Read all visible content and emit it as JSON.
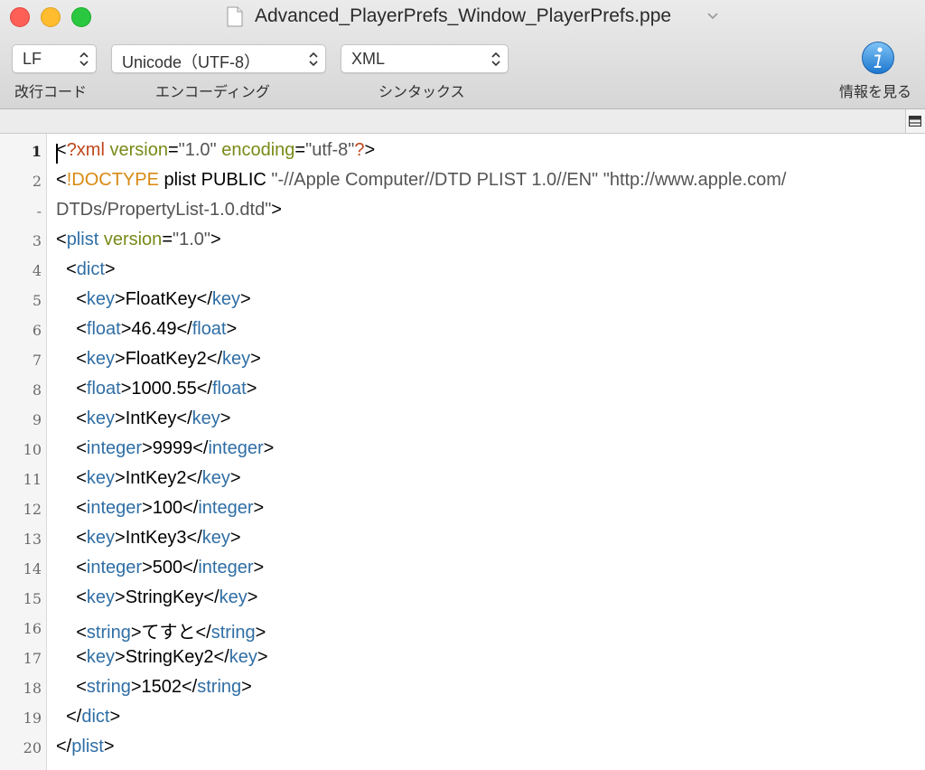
{
  "window": {
    "title": "Advanced_PlayerPrefs_Window_PlayerPrefs.ppe"
  },
  "toolbar": {
    "line_ending": {
      "value": "LF",
      "label": "改行コード"
    },
    "encoding": {
      "value": "Unicode（UTF-8）",
      "label": "エンコーディング"
    },
    "syntax": {
      "value": "XML",
      "label": "シンタックス"
    },
    "info": {
      "label": "情報を見る",
      "icon": "info-icon"
    }
  },
  "colors": {
    "tag": "#2f6ea5",
    "attribute": "#7a8a18",
    "value": "#555555",
    "declaration": "#c0471c",
    "doctype": "#d88a12",
    "text": "#000000"
  },
  "editor": {
    "current_line": 1,
    "lines": [
      {
        "number": "1",
        "tokens": [
          {
            "t": "<",
            "c": "text"
          },
          {
            "t": "?xml",
            "c": "declaration"
          },
          {
            "t": " ",
            "c": "text"
          },
          {
            "t": "version",
            "c": "attribute"
          },
          {
            "t": "=",
            "c": "text"
          },
          {
            "t": "\"1.0\"",
            "c": "value"
          },
          {
            "t": " ",
            "c": "text"
          },
          {
            "t": "encoding",
            "c": "attribute"
          },
          {
            "t": "=",
            "c": "text"
          },
          {
            "t": "\"utf-8\"",
            "c": "value"
          },
          {
            "t": "?",
            "c": "declaration"
          },
          {
            "t": ">",
            "c": "text"
          }
        ]
      },
      {
        "number": "2",
        "tokens": [
          {
            "t": "<",
            "c": "text"
          },
          {
            "t": "!DOCTYPE",
            "c": "doctype"
          },
          {
            "t": " plist PUBLIC ",
            "c": "text"
          },
          {
            "t": "\"-//Apple Computer//DTD PLIST 1.0//EN\" \"http://www.apple.com/",
            "c": "value"
          }
        ]
      },
      {
        "number": "-",
        "tokens": [
          {
            "t": "DTDs/PropertyList-1.0.dtd\"",
            "c": "value"
          },
          {
            "t": ">",
            "c": "text"
          }
        ]
      },
      {
        "number": "3",
        "tokens": [
          {
            "t": "<",
            "c": "text"
          },
          {
            "t": "plist",
            "c": "tag"
          },
          {
            "t": " ",
            "c": "text"
          },
          {
            "t": "version",
            "c": "attribute"
          },
          {
            "t": "=",
            "c": "text"
          },
          {
            "t": "\"1.0\"",
            "c": "value"
          },
          {
            "t": ">",
            "c": "text"
          }
        ]
      },
      {
        "number": "4",
        "tokens": [
          {
            "t": "  <",
            "c": "text"
          },
          {
            "t": "dict",
            "c": "tag"
          },
          {
            "t": ">",
            "c": "text"
          }
        ]
      },
      {
        "number": "5",
        "tokens": [
          {
            "t": "    <",
            "c": "text"
          },
          {
            "t": "key",
            "c": "tag"
          },
          {
            "t": ">FloatKey</",
            "c": "text"
          },
          {
            "t": "key",
            "c": "tag"
          },
          {
            "t": ">",
            "c": "text"
          }
        ]
      },
      {
        "number": "6",
        "tokens": [
          {
            "t": "    <",
            "c": "text"
          },
          {
            "t": "float",
            "c": "tag"
          },
          {
            "t": ">46.49</",
            "c": "text"
          },
          {
            "t": "float",
            "c": "tag"
          },
          {
            "t": ">",
            "c": "text"
          }
        ]
      },
      {
        "number": "7",
        "tokens": [
          {
            "t": "    <",
            "c": "text"
          },
          {
            "t": "key",
            "c": "tag"
          },
          {
            "t": ">FloatKey2</",
            "c": "text"
          },
          {
            "t": "key",
            "c": "tag"
          },
          {
            "t": ">",
            "c": "text"
          }
        ]
      },
      {
        "number": "8",
        "tokens": [
          {
            "t": "    <",
            "c": "text"
          },
          {
            "t": "float",
            "c": "tag"
          },
          {
            "t": ">1000.55</",
            "c": "text"
          },
          {
            "t": "float",
            "c": "tag"
          },
          {
            "t": ">",
            "c": "text"
          }
        ]
      },
      {
        "number": "9",
        "tokens": [
          {
            "t": "    <",
            "c": "text"
          },
          {
            "t": "key",
            "c": "tag"
          },
          {
            "t": ">IntKey</",
            "c": "text"
          },
          {
            "t": "key",
            "c": "tag"
          },
          {
            "t": ">",
            "c": "text"
          }
        ]
      },
      {
        "number": "10",
        "tokens": [
          {
            "t": "    <",
            "c": "text"
          },
          {
            "t": "integer",
            "c": "tag"
          },
          {
            "t": ">9999</",
            "c": "text"
          },
          {
            "t": "integer",
            "c": "tag"
          },
          {
            "t": ">",
            "c": "text"
          }
        ]
      },
      {
        "number": "11",
        "tokens": [
          {
            "t": "    <",
            "c": "text"
          },
          {
            "t": "key",
            "c": "tag"
          },
          {
            "t": ">IntKey2</",
            "c": "text"
          },
          {
            "t": "key",
            "c": "tag"
          },
          {
            "t": ">",
            "c": "text"
          }
        ]
      },
      {
        "number": "12",
        "tokens": [
          {
            "t": "    <",
            "c": "text"
          },
          {
            "t": "integer",
            "c": "tag"
          },
          {
            "t": ">100</",
            "c": "text"
          },
          {
            "t": "integer",
            "c": "tag"
          },
          {
            "t": ">",
            "c": "text"
          }
        ]
      },
      {
        "number": "13",
        "tokens": [
          {
            "t": "    <",
            "c": "text"
          },
          {
            "t": "key",
            "c": "tag"
          },
          {
            "t": ">IntKey3</",
            "c": "text"
          },
          {
            "t": "key",
            "c": "tag"
          },
          {
            "t": ">",
            "c": "text"
          }
        ]
      },
      {
        "number": "14",
        "tokens": [
          {
            "t": "    <",
            "c": "text"
          },
          {
            "t": "integer",
            "c": "tag"
          },
          {
            "t": ">500</",
            "c": "text"
          },
          {
            "t": "integer",
            "c": "tag"
          },
          {
            "t": ">",
            "c": "text"
          }
        ]
      },
      {
        "number": "15",
        "tokens": [
          {
            "t": "    <",
            "c": "text"
          },
          {
            "t": "key",
            "c": "tag"
          },
          {
            "t": ">StringKey</",
            "c": "text"
          },
          {
            "t": "key",
            "c": "tag"
          },
          {
            "t": ">",
            "c": "text"
          }
        ]
      },
      {
        "number": "16",
        "tokens": [
          {
            "t": "    <",
            "c": "text"
          },
          {
            "t": "string",
            "c": "tag"
          },
          {
            "t": ">てすと</",
            "c": "text"
          },
          {
            "t": "string",
            "c": "tag"
          },
          {
            "t": ">",
            "c": "text"
          }
        ]
      },
      {
        "number": "17",
        "tokens": [
          {
            "t": "    <",
            "c": "text"
          },
          {
            "t": "key",
            "c": "tag"
          },
          {
            "t": ">StringKey2</",
            "c": "text"
          },
          {
            "t": "key",
            "c": "tag"
          },
          {
            "t": ">",
            "c": "text"
          }
        ]
      },
      {
        "number": "18",
        "tokens": [
          {
            "t": "    <",
            "c": "text"
          },
          {
            "t": "string",
            "c": "tag"
          },
          {
            "t": ">1502</",
            "c": "text"
          },
          {
            "t": "string",
            "c": "tag"
          },
          {
            "t": ">",
            "c": "text"
          }
        ]
      },
      {
        "number": "19",
        "tokens": [
          {
            "t": "  </",
            "c": "text"
          },
          {
            "t": "dict",
            "c": "tag"
          },
          {
            "t": ">",
            "c": "text"
          }
        ]
      },
      {
        "number": "20",
        "tokens": [
          {
            "t": "</",
            "c": "text"
          },
          {
            "t": "plist",
            "c": "tag"
          },
          {
            "t": ">",
            "c": "text"
          }
        ]
      }
    ]
  }
}
